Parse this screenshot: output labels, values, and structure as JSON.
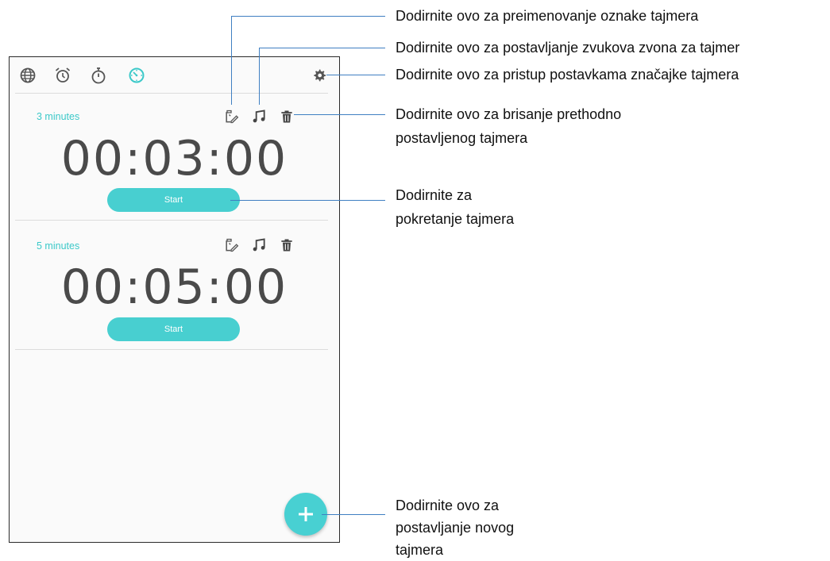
{
  "tabs": [
    {
      "icon": "globe-icon"
    },
    {
      "icon": "alarm-clock-icon"
    },
    {
      "icon": "stopwatch-icon"
    },
    {
      "icon": "timer-icon",
      "active": true
    }
  ],
  "settings_icon": "gear-icon",
  "timers": [
    {
      "label": "3 minutes",
      "time": "00:03:00",
      "start_label": "Start"
    },
    {
      "label": "5 minutes",
      "time": "00:05:00",
      "start_label": "Start"
    }
  ],
  "add_button_icon": "plus-icon",
  "callouts": {
    "rename": "Dodirnite ovo za preimenovanje oznake tajmera",
    "ringtone": "Dodirnite ovo za postavljanje zvukova zvona za tajmer",
    "settings": "Dodirnite ovo za pristup postavkama značajke tajmera",
    "delete_1": "Dodirnite ovo za brisanje prethodno",
    "delete_2": "postavljenog tajmera",
    "start_1": "Dodirnite za",
    "start_2": "pokretanje tajmera",
    "add_1": "Dodirnite ovo za",
    "add_2": "postavljanje novog",
    "add_3": "tajmera"
  },
  "colors": {
    "accent": "#48cfd0",
    "callout_line": "#3f7fc2",
    "text": "#4a4a4a"
  }
}
